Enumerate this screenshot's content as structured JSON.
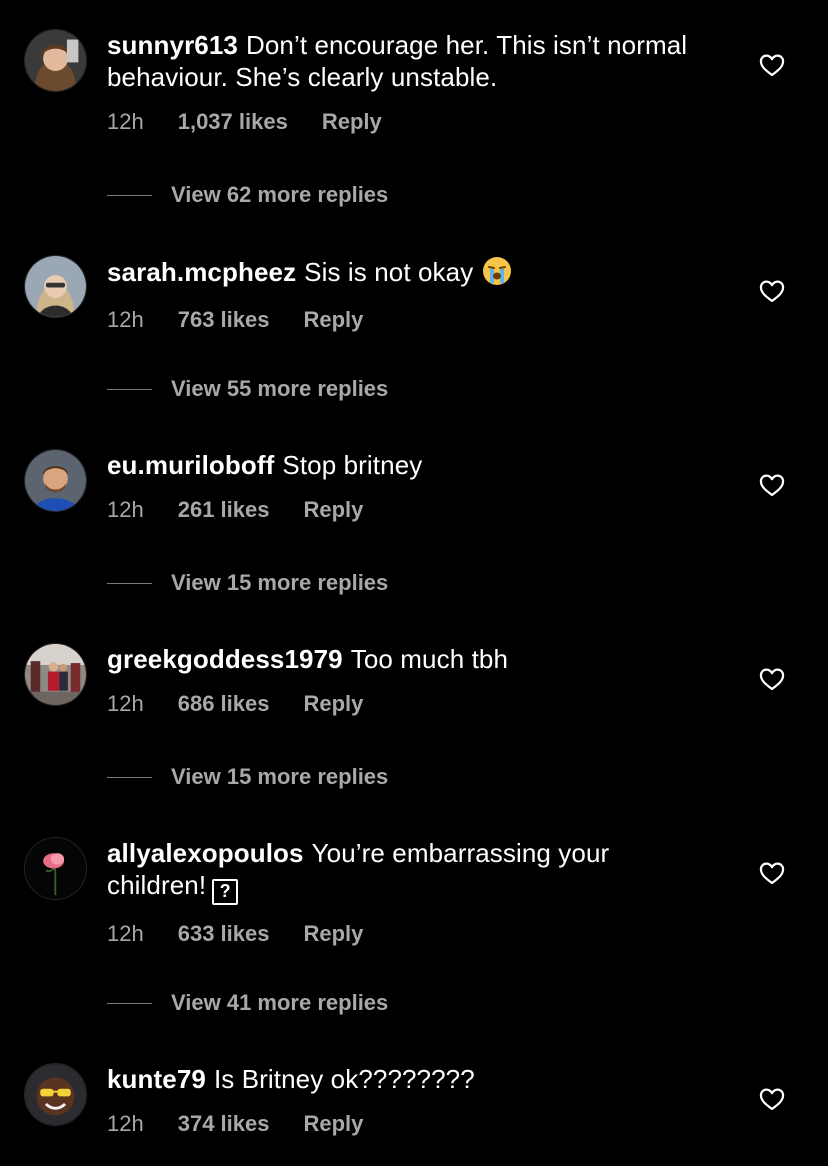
{
  "comments": [
    {
      "username": "sunnyr613",
      "text": "Don’t encourage her. This isn’t normal behaviour. She’s clearly unstable.",
      "time": "12h",
      "likes": "1,037 likes",
      "reply": "Reply",
      "view_replies": "View 62 more replies"
    },
    {
      "username": "sarah.mcpheez",
      "text": "Sis is not okay",
      "emoji": "loudly-crying-face",
      "time": "12h",
      "likes": "763 likes",
      "reply": "Reply",
      "view_replies": "View 55 more replies"
    },
    {
      "username": "eu.muriloboff",
      "text": "Stop britney",
      "time": "12h",
      "likes": "261 likes",
      "reply": "Reply",
      "view_replies": "View 15 more replies"
    },
    {
      "username": "greekgoddess1979",
      "text": "Too much tbh",
      "time": "12h",
      "likes": "686 likes",
      "reply": "Reply",
      "view_replies": "View 15 more replies"
    },
    {
      "username": "allyalexopoulos",
      "text": "You’re embarrassing your children!",
      "glyph": "?",
      "time": "12h",
      "likes": "633 likes",
      "reply": "Reply",
      "view_replies": "View 41 more replies"
    },
    {
      "username": "kunte79",
      "text": "Is Britney ok????????",
      "time": "12h",
      "likes": "374 likes",
      "reply": "Reply"
    }
  ],
  "icons": {
    "like": "heart-outline-icon"
  },
  "colors": {
    "background": "#000000",
    "primary_text": "#ffffff",
    "secondary_text": "#a8a8a8"
  }
}
